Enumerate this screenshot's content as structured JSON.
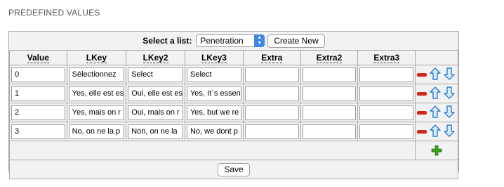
{
  "section": {
    "title": "PREDEFINED VALUES"
  },
  "list_selector": {
    "label": "Select a list:",
    "selected": "Penetration",
    "create_label": "Create New"
  },
  "table": {
    "headers": [
      "Value",
      "LKey",
      "LKey2",
      "LKey3",
      "Extra",
      "Extra2",
      "Extra3"
    ],
    "rows": [
      {
        "value": "0",
        "lkey": "Sélectionnez",
        "lkey2": "Select",
        "lkey3": "Select",
        "extra": "",
        "extra2": "",
        "extra3": ""
      },
      {
        "value": "1",
        "lkey": "Yes, elle est es",
        "lkey2": "Oui, elle est es",
        "lkey3": "Yes, It`s essen",
        "extra": "",
        "extra2": "",
        "extra3": ""
      },
      {
        "value": "2",
        "lkey": "Yes, mais on r",
        "lkey2": "Oui, mais on r",
        "lkey3": "Yes, but we re",
        "extra": "",
        "extra2": "",
        "extra3": ""
      },
      {
        "value": "3",
        "lkey": "No, on ne la p",
        "lkey2": "Non, on ne la",
        "lkey3": "No, we dont p",
        "extra": "",
        "extra2": "",
        "extra3": ""
      }
    ]
  },
  "icons": {
    "remove": "minus-icon",
    "move_up": "arrow-up-icon",
    "move_down": "arrow-down-icon",
    "add": "plus-icon"
  },
  "colors": {
    "remove": "#d4271c",
    "arrows": "#2b7fd6",
    "add": "#3aa31c"
  },
  "footer": {
    "save_label": "Save"
  }
}
